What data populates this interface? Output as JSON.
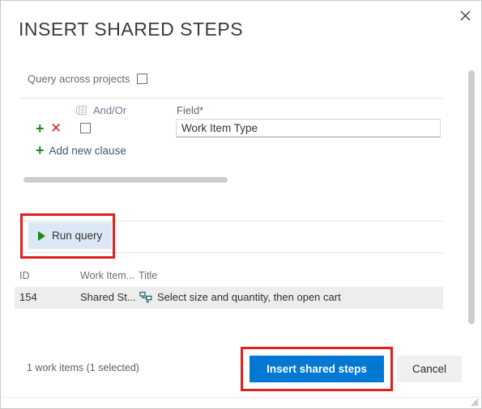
{
  "dialog": {
    "title": "INSERT SHARED STEPS",
    "close_icon": "close-icon"
  },
  "query_options": {
    "across_projects_label": "Query across projects",
    "across_projects_checked": false
  },
  "clause_editor": {
    "columns": {
      "group_icon": "group-clauses-icon",
      "and_or": "And/Or",
      "field": "Field*"
    },
    "rows": [
      {
        "add_icon": "plus-icon",
        "delete_icon": "delete-x-icon",
        "group_checked": false,
        "field_value": "Work Item Type",
        "field_placeholder": "Field"
      }
    ],
    "add_new_clause_label": "Add new clause",
    "add_new_clause_icon": "plus-icon"
  },
  "run_query": {
    "label": "Run query",
    "icon": "play-icon"
  },
  "results": {
    "columns": [
      "ID",
      "Work Item...",
      "Title"
    ],
    "rows": [
      {
        "id": "154",
        "work_item_type": "Shared St...",
        "type_icon": "shared-steps-icon",
        "title": "Select size and quantity, then open cart",
        "selected": true
      }
    ]
  },
  "footer": {
    "status": "1 work items (1 selected)",
    "primary_button": "Insert shared steps",
    "secondary_button": "Cancel"
  },
  "colors": {
    "accent": "#0078d4",
    "highlight_box": "#e02020",
    "run_query_bg": "#dce8f5",
    "row_selected_bg": "#ededed",
    "plus_green": "#1f8a1f",
    "delete_red": "#cc2b2b",
    "shared_steps_icon": "#1f5c63"
  }
}
